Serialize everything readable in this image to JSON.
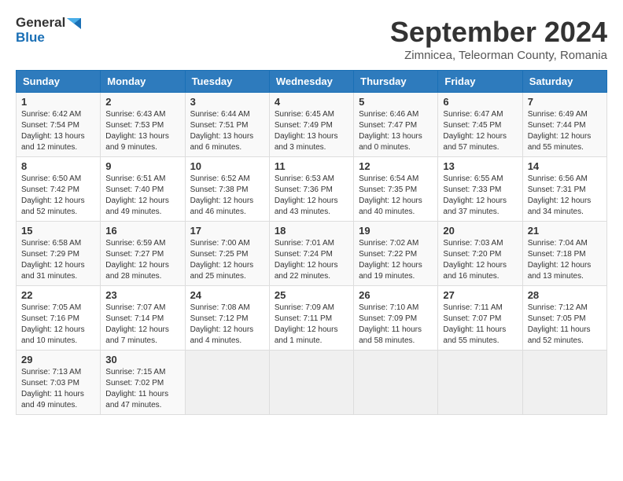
{
  "logo": {
    "line1": "General",
    "line2": "Blue"
  },
  "title": "September 2024",
  "location": "Zimnicea, Teleorman County, Romania",
  "headers": [
    "Sunday",
    "Monday",
    "Tuesday",
    "Wednesday",
    "Thursday",
    "Friday",
    "Saturday"
  ],
  "weeks": [
    [
      {
        "day": "1",
        "sunrise": "6:42 AM",
        "sunset": "7:54 PM",
        "daylight": "13 hours and 12 minutes."
      },
      {
        "day": "2",
        "sunrise": "6:43 AM",
        "sunset": "7:53 PM",
        "daylight": "13 hours and 9 minutes."
      },
      {
        "day": "3",
        "sunrise": "6:44 AM",
        "sunset": "7:51 PM",
        "daylight": "13 hours and 6 minutes."
      },
      {
        "day": "4",
        "sunrise": "6:45 AM",
        "sunset": "7:49 PM",
        "daylight": "13 hours and 3 minutes."
      },
      {
        "day": "5",
        "sunrise": "6:46 AM",
        "sunset": "7:47 PM",
        "daylight": "13 hours and 0 minutes."
      },
      {
        "day": "6",
        "sunrise": "6:47 AM",
        "sunset": "7:45 PM",
        "daylight": "12 hours and 57 minutes."
      },
      {
        "day": "7",
        "sunrise": "6:49 AM",
        "sunset": "7:44 PM",
        "daylight": "12 hours and 55 minutes."
      }
    ],
    [
      {
        "day": "8",
        "sunrise": "6:50 AM",
        "sunset": "7:42 PM",
        "daylight": "12 hours and 52 minutes."
      },
      {
        "day": "9",
        "sunrise": "6:51 AM",
        "sunset": "7:40 PM",
        "daylight": "12 hours and 49 minutes."
      },
      {
        "day": "10",
        "sunrise": "6:52 AM",
        "sunset": "7:38 PM",
        "daylight": "12 hours and 46 minutes."
      },
      {
        "day": "11",
        "sunrise": "6:53 AM",
        "sunset": "7:36 PM",
        "daylight": "12 hours and 43 minutes."
      },
      {
        "day": "12",
        "sunrise": "6:54 AM",
        "sunset": "7:35 PM",
        "daylight": "12 hours and 40 minutes."
      },
      {
        "day": "13",
        "sunrise": "6:55 AM",
        "sunset": "7:33 PM",
        "daylight": "12 hours and 37 minutes."
      },
      {
        "day": "14",
        "sunrise": "6:56 AM",
        "sunset": "7:31 PM",
        "daylight": "12 hours and 34 minutes."
      }
    ],
    [
      {
        "day": "15",
        "sunrise": "6:58 AM",
        "sunset": "7:29 PM",
        "daylight": "12 hours and 31 minutes."
      },
      {
        "day": "16",
        "sunrise": "6:59 AM",
        "sunset": "7:27 PM",
        "daylight": "12 hours and 28 minutes."
      },
      {
        "day": "17",
        "sunrise": "7:00 AM",
        "sunset": "7:25 PM",
        "daylight": "12 hours and 25 minutes."
      },
      {
        "day": "18",
        "sunrise": "7:01 AM",
        "sunset": "7:24 PM",
        "daylight": "12 hours and 22 minutes."
      },
      {
        "day": "19",
        "sunrise": "7:02 AM",
        "sunset": "7:22 PM",
        "daylight": "12 hours and 19 minutes."
      },
      {
        "day": "20",
        "sunrise": "7:03 AM",
        "sunset": "7:20 PM",
        "daylight": "12 hours and 16 minutes."
      },
      {
        "day": "21",
        "sunrise": "7:04 AM",
        "sunset": "7:18 PM",
        "daylight": "12 hours and 13 minutes."
      }
    ],
    [
      {
        "day": "22",
        "sunrise": "7:05 AM",
        "sunset": "7:16 PM",
        "daylight": "12 hours and 10 minutes."
      },
      {
        "day": "23",
        "sunrise": "7:07 AM",
        "sunset": "7:14 PM",
        "daylight": "12 hours and 7 minutes."
      },
      {
        "day": "24",
        "sunrise": "7:08 AM",
        "sunset": "7:12 PM",
        "daylight": "12 hours and 4 minutes."
      },
      {
        "day": "25",
        "sunrise": "7:09 AM",
        "sunset": "7:11 PM",
        "daylight": "12 hours and 1 minute."
      },
      {
        "day": "26",
        "sunrise": "7:10 AM",
        "sunset": "7:09 PM",
        "daylight": "11 hours and 58 minutes."
      },
      {
        "day": "27",
        "sunrise": "7:11 AM",
        "sunset": "7:07 PM",
        "daylight": "11 hours and 55 minutes."
      },
      {
        "day": "28",
        "sunrise": "7:12 AM",
        "sunset": "7:05 PM",
        "daylight": "11 hours and 52 minutes."
      }
    ],
    [
      {
        "day": "29",
        "sunrise": "7:13 AM",
        "sunset": "7:03 PM",
        "daylight": "11 hours and 49 minutes."
      },
      {
        "day": "30",
        "sunrise": "7:15 AM",
        "sunset": "7:02 PM",
        "daylight": "11 hours and 47 minutes."
      },
      null,
      null,
      null,
      null,
      null
    ]
  ]
}
